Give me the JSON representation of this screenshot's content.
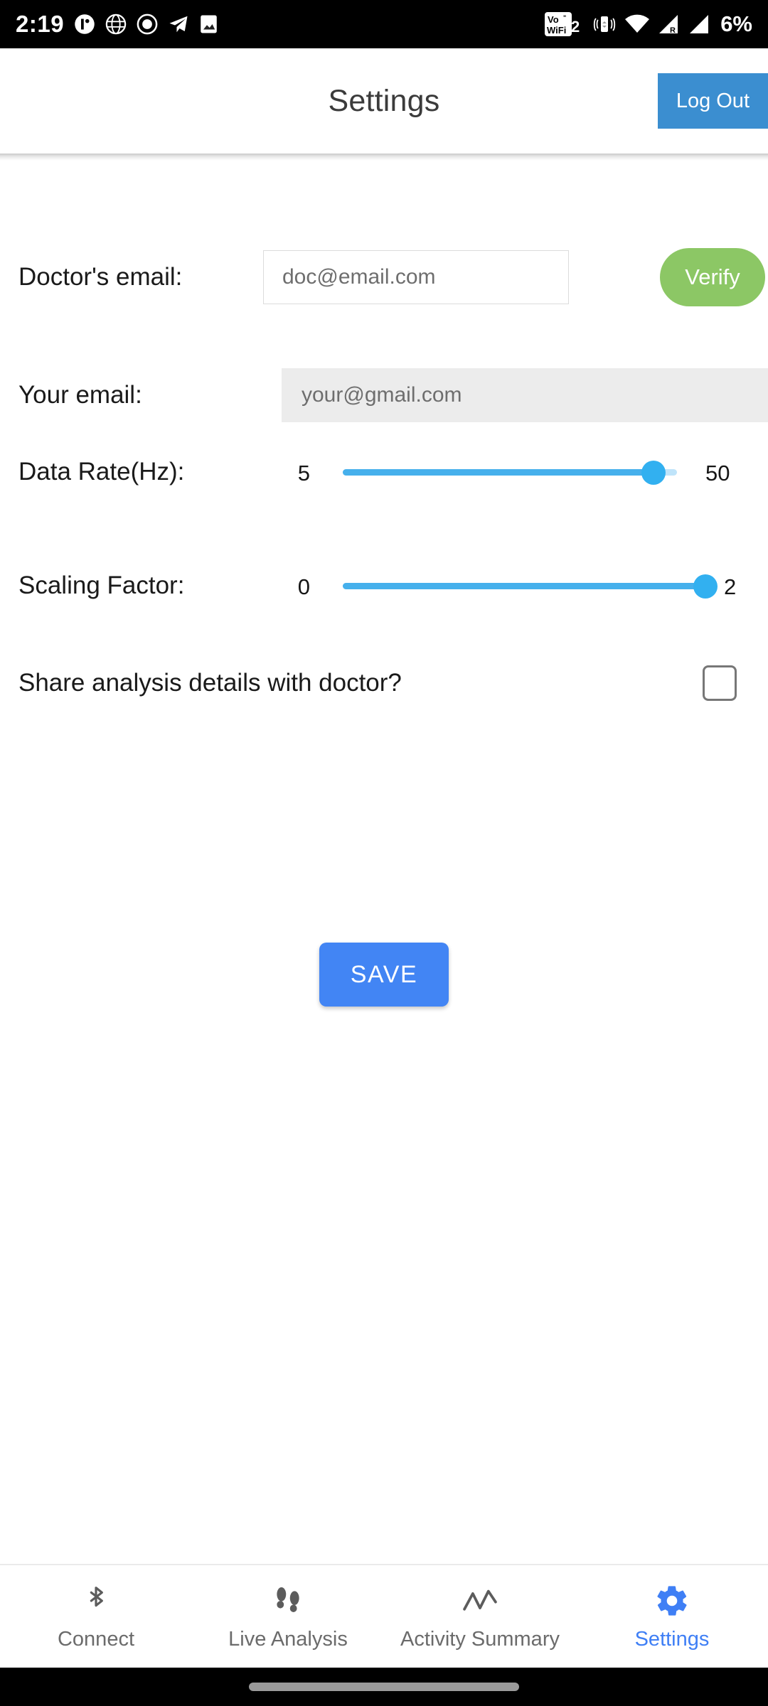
{
  "status_bar": {
    "time": "2:19",
    "battery": "6%",
    "vowifi_label": "Vo WiFi",
    "vowifi_sim": "2",
    "left_icons": [
      "notification-badge-icon",
      "globe-icon",
      "record-circle-icon",
      "telegram-icon",
      "image-icon"
    ],
    "right_icons": [
      "vowifi-icon",
      "vibrate-icon",
      "wifi-icon",
      "cellular-roaming-icon",
      "cellular-signal-icon"
    ],
    "roaming_letter": "R"
  },
  "app_bar": {
    "title": "Settings",
    "logout_label": "Log Out",
    "logout_color": "#3b8ed0"
  },
  "form": {
    "doctor_email": {
      "label": "Doctor's email:",
      "placeholder": "doc@email.com",
      "value": "",
      "verify_label": "Verify",
      "verify_color": "#8cc765"
    },
    "your_email": {
      "label": "Your email:",
      "placeholder": "your@gmail.com",
      "value": "",
      "readonly": true
    },
    "data_rate": {
      "label": "Data Rate(Hz):",
      "min_label": "5",
      "max_label": "50",
      "min": 5,
      "max": 50,
      "value": 47,
      "fill_percent": 93,
      "accent": "#32b0f0"
    },
    "scaling_factor": {
      "label": "Scaling Factor:",
      "min_label": "0",
      "max_label": "2",
      "min": 0,
      "max": 2,
      "value": 2,
      "fill_percent": 100,
      "accent": "#32b0f0"
    },
    "share_details": {
      "label": "Share analysis details with doctor?",
      "checked": false
    },
    "save_label": "SAVE",
    "save_color": "#4285f4"
  },
  "bottom_nav": {
    "active_color": "#3f7ff5",
    "inactive_color": "#6b6b6b",
    "items": [
      {
        "label": "Connect",
        "icon": "bluetooth-icon",
        "active": false
      },
      {
        "label": "Live Analysis",
        "icon": "footsteps-icon",
        "active": false
      },
      {
        "label": "Activity Summary",
        "icon": "line-chart-icon",
        "active": false
      },
      {
        "label": "Settings",
        "icon": "gear-icon",
        "active": true
      }
    ]
  }
}
